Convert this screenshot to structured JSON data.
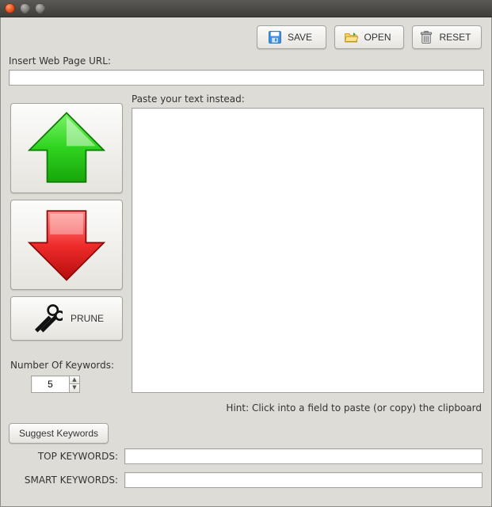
{
  "toolbar": {
    "save_label": "SAVE",
    "open_label": "OPEN",
    "reset_label": "RESET"
  },
  "url_section": {
    "label": "Insert Web Page URL:",
    "value": ""
  },
  "left": {
    "prune_label": "PRUNE",
    "num_keywords_label": "Number Of Keywords:",
    "num_keywords_value": "5"
  },
  "paste": {
    "label": "Paste your text instead:",
    "value": ""
  },
  "hint": "Hint: Click into a field to paste (or copy) the clipboard",
  "bottom": {
    "suggest_label": "Suggest Keywords",
    "top_kw_label": "TOP KEYWORDS:",
    "top_kw_value": "",
    "smart_kw_label": "SMART KEYWORDS:",
    "smart_kw_value": ""
  }
}
